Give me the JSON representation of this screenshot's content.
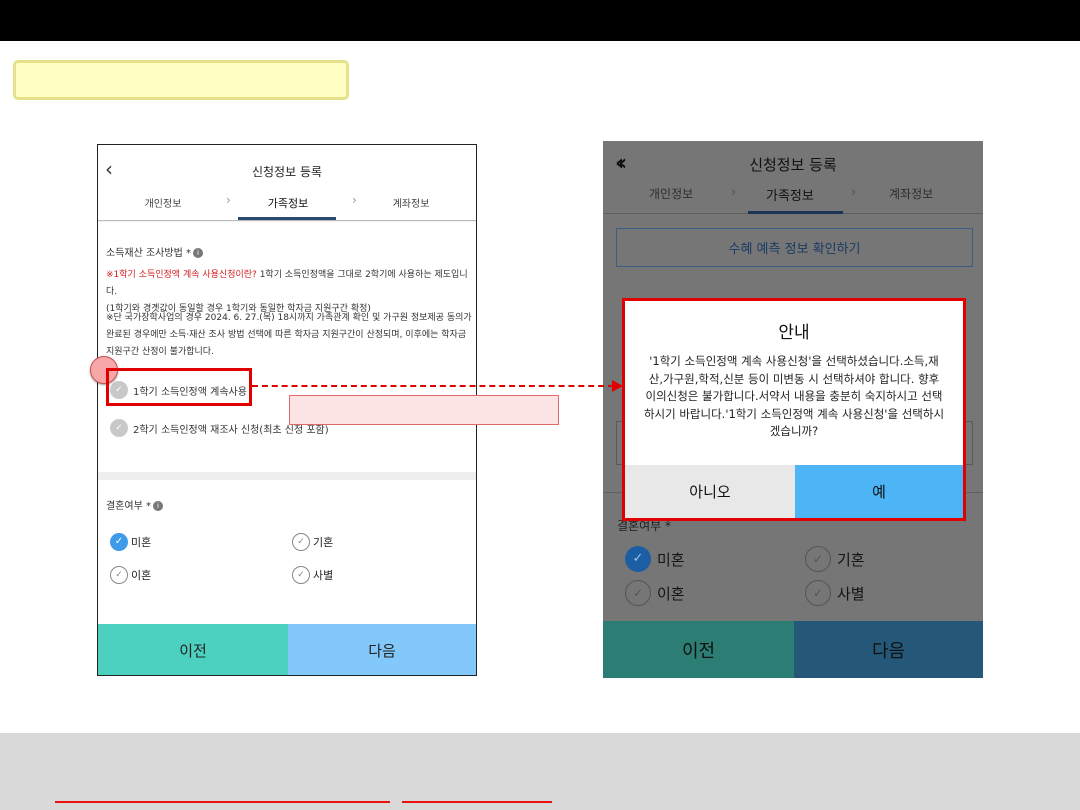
{
  "left_phone": {
    "back_icon": "chevron-left-icon",
    "title": "신청정보 등록",
    "tabs": [
      "개인정보",
      "가족정보",
      "계좌정보"
    ],
    "income_label": "소득재산 조사방법 *",
    "notice_red": "※1학기 소득인정액 계속 사용신청이란?",
    "notice_1_rest": " 1학기 소득인정액을 그대로 2학기에 사용하는 제도입니다.",
    "notice_1_line2": "(1학기와 경곗값이 동일할 경우 1학기와 동일한 학자금 지원구간 확정)",
    "notice_2": "※단 국가장학사업의 경우 2024. 6. 27.(목) 18시까지 가족관계 확인 및 가구원 정보제공 동의가 완료된 경우에만 소득·재산 조사 방법 선택에 따른 학자금 지원구간이 산정되며, 이후에는 학자금 지원구간 산정이 불가합니다.",
    "option_1": "1학기 소득인정액 계속사용",
    "option_2": "2학기 소득인정액 재조사 신청(최초 신청 포함)",
    "marriage_label": "결혼여부 *",
    "marriage_options": [
      "미혼",
      "기혼",
      "이혼",
      "사별"
    ],
    "selected_marriage": "미혼",
    "prev_button": "이전",
    "next_button": "다음"
  },
  "right_phone": {
    "title": "신청정보 등록",
    "tabs": [
      "개인정보",
      "가족정보",
      "계좌정보"
    ],
    "confirm_button": "수혜 예측 정보 확인하기",
    "marriage_label": "결혼여부 *",
    "marriage_options": [
      "미혼",
      "기혼",
      "이혼",
      "사별"
    ],
    "prev_button": "이전",
    "next_button": "다음"
  },
  "dialog": {
    "title": "안내",
    "body": "'1학기 소득인정액 계속 사용신청'을 선택하셨습니다.소득,재산,가구원,학적,신분 등이 미변동 시 선택하셔야 합니다. 향후 이의신청은 불가합니다.서약서 내용을 충분히 숙지하시고 선택하시기 바랍니다.'1학기 소득인정액 계속 사용신청'을 선택하시겠습니까?",
    "no_button": "아니오",
    "yes_button": "예"
  },
  "colors": {
    "highlight_red": "#e00000",
    "teal": "#4cd0bf",
    "light_blue": "#82c8fa"
  }
}
